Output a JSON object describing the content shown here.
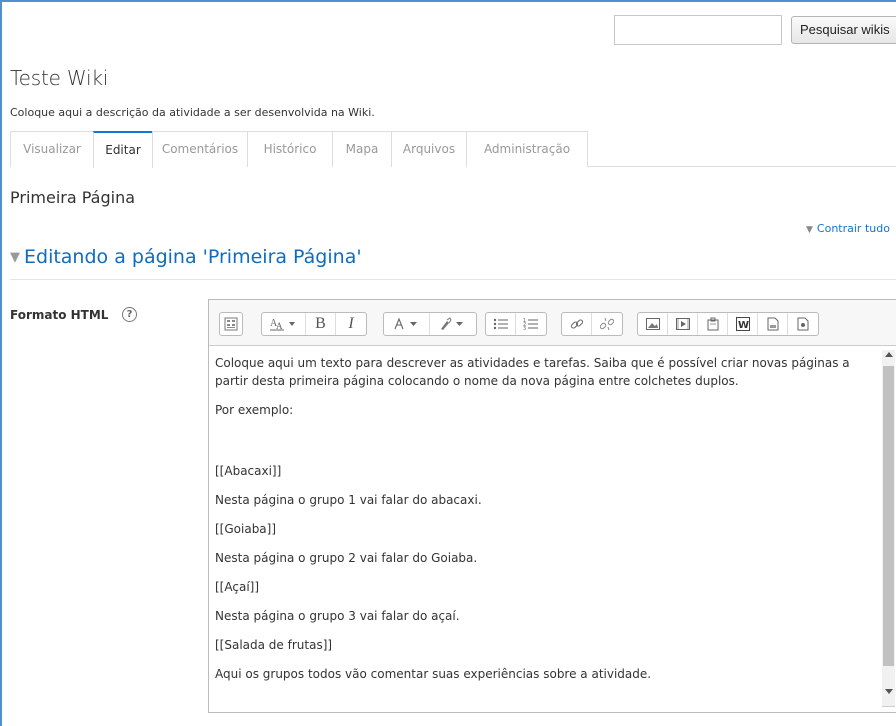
{
  "search": {
    "placeholder": "",
    "button_label": "Pesquisar wikis"
  },
  "wiki": {
    "title": "Teste Wiki",
    "description": "Coloque aqui a descrição da atividade a ser desenvolvida na Wiki."
  },
  "tabs": [
    {
      "label": "Visualizar",
      "active": false
    },
    {
      "label": "Editar",
      "active": true
    },
    {
      "label": "Comentários",
      "active": false
    },
    {
      "label": "Histórico",
      "active": false
    },
    {
      "label": "Mapa",
      "active": false
    },
    {
      "label": "Arquivos",
      "active": false
    },
    {
      "label": "Administração",
      "active": false
    }
  ],
  "page": {
    "title": "Primeira Página",
    "collapse_all": "Contrair tudo",
    "section_heading": "Editando a página 'Primeira Página'"
  },
  "field": {
    "label": "Formato HTML"
  },
  "toolbar": {
    "icons": [
      "show-more-icon",
      "font-style-icon",
      "bold-icon",
      "italic-icon",
      "font-color-icon",
      "background-color-icon",
      "unordered-list-icon",
      "ordered-list-icon",
      "link-icon",
      "unlink-icon",
      "image-icon",
      "media-icon",
      "manage-files-icon",
      "word-import-icon",
      "h5p-icon",
      "record-icon"
    ],
    "bold_glyph": "B",
    "italic_glyph": "I"
  },
  "editor": {
    "paragraphs": [
      "Coloque aqui um texto para descrever as atividades e tarefas. Saiba que é possível criar novas páginas a partir desta primeira página colocando o nome da nova página entre colchetes duplos.",
      "Por exemplo:",
      "[[Abacaxi]]",
      "Nesta página o grupo 1 vai falar do abacaxi.",
      "[[Goiaba]]",
      "Nesta página o grupo 2 vai falar do Goiaba.",
      "[[Açaí]]",
      "Nesta página o grupo 3 vai falar do açaí.",
      "[[Salada de frutas]]",
      "Aqui os grupos todos vão comentar suas experiências sobre a atividade."
    ]
  },
  "colors": {
    "accent": "#1177d1",
    "heading": "#0f6cbf",
    "frame": "#4f91cd"
  }
}
